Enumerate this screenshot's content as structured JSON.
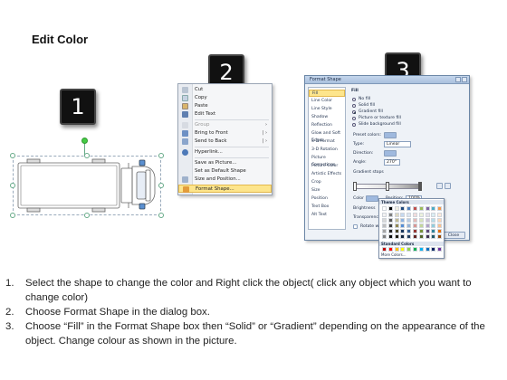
{
  "page": {
    "title": "Edit Color"
  },
  "steps": [
    "1",
    "2",
    "3"
  ],
  "context_menu": {
    "items": [
      {
        "label": "Cut",
        "underline": "t",
        "icon": "cut-icon",
        "enabled": true,
        "submenu": false
      },
      {
        "label": "Copy",
        "icon": "copy-icon",
        "enabled": true,
        "submenu": false
      },
      {
        "label": "Paste",
        "icon": "paste-icon",
        "enabled": true,
        "submenu": false
      },
      {
        "label": "Edit Text",
        "icon": "edit-text-icon",
        "enabled": true,
        "submenu": false
      },
      {
        "label": "Group",
        "icon": "group-icon",
        "enabled": false,
        "submenu": true
      },
      {
        "label": "Bring to Front",
        "icon": "bring-front-icon",
        "enabled": true,
        "submenu": true
      },
      {
        "label": "Send to Back",
        "icon": "send-back-icon",
        "enabled": true,
        "submenu": true
      },
      {
        "label": "Hyperlink...",
        "icon": "hyperlink-icon",
        "enabled": true,
        "submenu": false
      },
      {
        "label": "Save as Picture...",
        "icon": "",
        "enabled": true,
        "submenu": false
      },
      {
        "label": "Set as Default Shape",
        "icon": "",
        "enabled": true,
        "submenu": false
      },
      {
        "label": "Size and Position...",
        "icon": "size-position-icon",
        "enabled": true,
        "submenu": false
      },
      {
        "label": "Format Shape...",
        "icon": "format-shape-icon",
        "enabled": true,
        "submenu": false,
        "highlighted": true
      }
    ]
  },
  "format_dialog": {
    "title": "Format Shape",
    "nav": [
      "Fill",
      "Line Color",
      "Line Style",
      "Shadow",
      "Reflection",
      "Glow and Soft Edges",
      "3-D Format",
      "3-D Rotation",
      "Picture Corrections",
      "Picture Color",
      "Artistic Effects",
      "Crop",
      "Size",
      "Position",
      "Text Box",
      "Alt Text"
    ],
    "active_nav": "Fill",
    "section_title": "Fill",
    "fill_options": [
      {
        "label": "No fill",
        "selected": false
      },
      {
        "label": "Solid fill",
        "selected": false
      },
      {
        "label": "Gradient fill",
        "selected": true
      },
      {
        "label": "Picture or texture fill",
        "selected": false
      },
      {
        "label": "Slide background fill",
        "selected": false
      }
    ],
    "preset_colors_label": "Preset colors:",
    "type_label": "Type:",
    "type_value": "Linear",
    "direction_label": "Direction:",
    "angle_label": "Angle:",
    "angle_value": "270°",
    "gradient_stops_label": "Gradient stops",
    "color_label": "Color",
    "position_label": "Position:",
    "position_value": "100%",
    "brightness_label": "Brightness",
    "transparency_label": "Transparency",
    "rotate_label": "Rotate with shape",
    "close_label": "Close"
  },
  "palette": {
    "theme_label": "Theme Colors",
    "standard_label": "Standard Colors",
    "more_label": "More Colors...",
    "theme_top": [
      "#ffffff",
      "#000000",
      "#eeece1",
      "#1f497d",
      "#4f81bd",
      "#c0504d",
      "#9bbb59",
      "#8064a2",
      "#4bacc6",
      "#f79646"
    ],
    "theme_rows": [
      [
        "#f2f2f2",
        "#7f7f7f",
        "#ddd9c3",
        "#c6d9f0",
        "#dbe5f1",
        "#f2dcdb",
        "#ebf1dd",
        "#e5e0ec",
        "#dbeef3",
        "#fdeada"
      ],
      [
        "#d8d8d8",
        "#595959",
        "#c4bd97",
        "#8db3e2",
        "#b8cce4",
        "#e5b9b7",
        "#d7e3bc",
        "#ccc1d9",
        "#b7dde8",
        "#fbd5b5"
      ],
      [
        "#bfbfbf",
        "#3f3f3f",
        "#938953",
        "#548dd4",
        "#95b3d7",
        "#d99694",
        "#c3d69b",
        "#b2a2c7",
        "#92cddc",
        "#fac08f"
      ],
      [
        "#a5a5a5",
        "#262626",
        "#494429",
        "#17365d",
        "#366092",
        "#953734",
        "#76923c",
        "#5f497a",
        "#31859b",
        "#e36c09"
      ],
      [
        "#7f7f7f",
        "#0c0c0c",
        "#1d1b10",
        "#0f243e",
        "#244061",
        "#632423",
        "#4f6128",
        "#3f3151",
        "#205867",
        "#974806"
      ]
    ],
    "standard": [
      "#c00000",
      "#ff0000",
      "#ffc000",
      "#ffff00",
      "#92d050",
      "#00b050",
      "#00b0f0",
      "#0070c0",
      "#002060",
      "#7030a0"
    ]
  },
  "instructions": [
    {
      "num": "1.",
      "text": "Select the shape to change the color and Right click the object( click any object which you want to change color)"
    },
    {
      "num": "2.",
      "text": "Choose Format Shape in the dialog box."
    },
    {
      "num": "3.",
      "text": "Choose “Fill” in the Format Shape box then “Solid” or “Gradient” depending on the appearance of the object. Change colour as shown in the picture."
    }
  ]
}
